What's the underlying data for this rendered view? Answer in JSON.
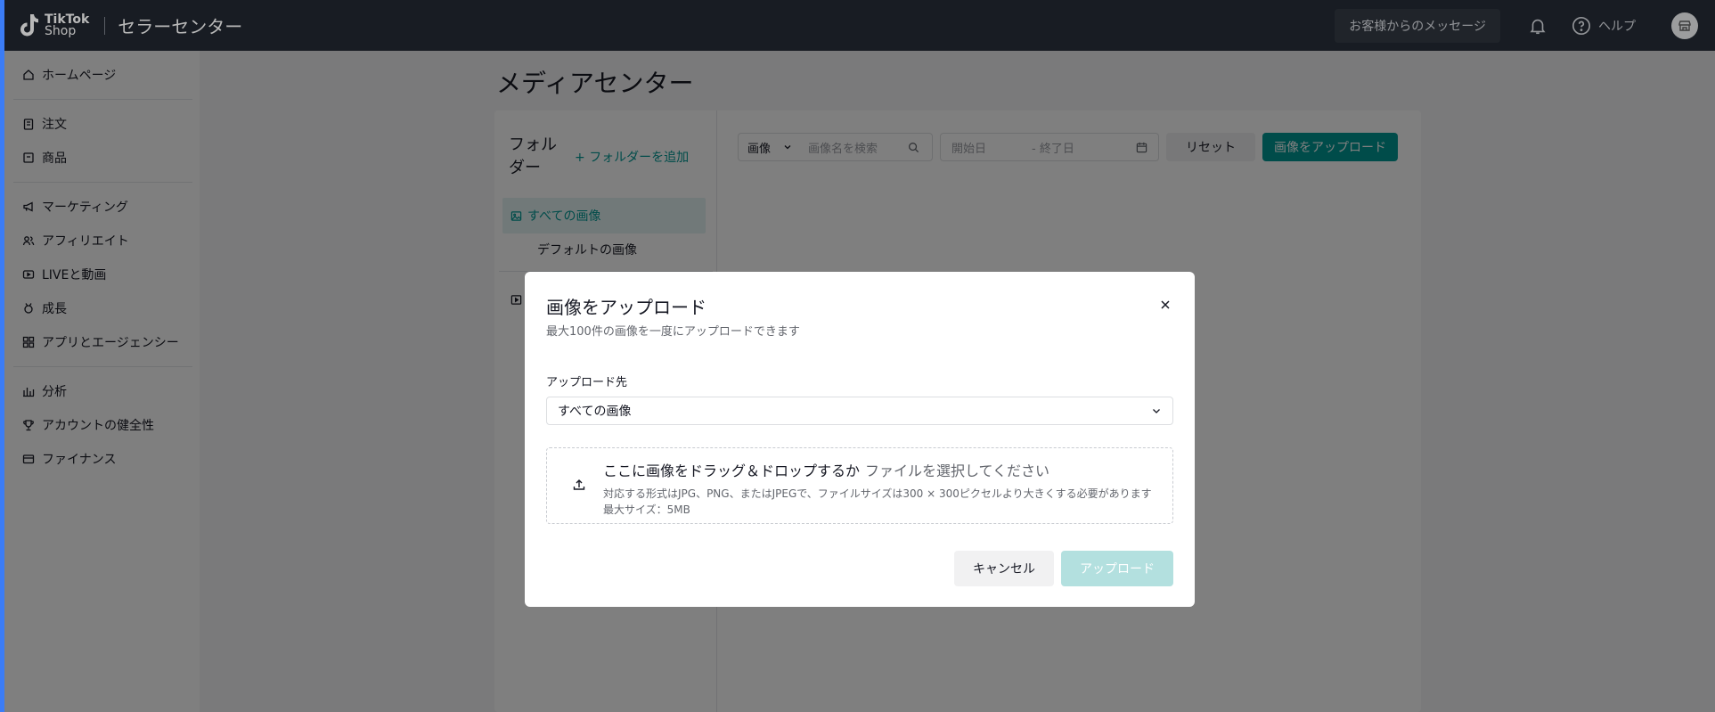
{
  "header": {
    "logo_line1": "TikTok",
    "logo_line2": "Shop",
    "center_title": "セラーセンター",
    "messages_button": "お客様からのメッセージ",
    "help_label": "ヘルプ"
  },
  "sidebar": {
    "groups": [
      [
        {
          "label": "ホームページ",
          "icon": "home-icon"
        }
      ],
      [
        {
          "label": "注文",
          "icon": "clipboard-icon"
        },
        {
          "label": "商品",
          "icon": "box-icon"
        }
      ],
      [
        {
          "label": "マーケティング",
          "icon": "megaphone-icon"
        },
        {
          "label": "アフィリエイト",
          "icon": "users-icon"
        },
        {
          "label": "LIVEと動画",
          "icon": "video-icon"
        },
        {
          "label": "成長",
          "icon": "medal-icon"
        },
        {
          "label": "アプリとエージェンシー",
          "icon": "apps-icon"
        }
      ],
      [
        {
          "label": "分析",
          "icon": "bar-chart-icon"
        },
        {
          "label": "アカウントの健全性",
          "icon": "trophy-icon"
        },
        {
          "label": "ファイナンス",
          "icon": "card-icon"
        }
      ]
    ]
  },
  "main": {
    "page_title": "メディアセンター",
    "folders": {
      "heading": "フォルダー",
      "add_folder": "フォルダーを追加",
      "all_images": "すべての画像",
      "default_images": "デフォルトの画像"
    },
    "filters": {
      "type": "画像",
      "search_placeholder": "画像名を検索",
      "start_date": "開始日",
      "end_date": "- 終了日",
      "reset": "リセット",
      "upload": "画像をアップロード"
    }
  },
  "modal": {
    "title": "画像をアップロード",
    "subtitle": "最大100件の画像を一度にアップロードできます",
    "destination_label": "アップロード先",
    "destination_value": "すべての画像",
    "drop_text": "ここに画像をドラッグ＆ドロップするか",
    "drop_link": "ファイルを選択してください",
    "hint_formats": "対応する形式はJPG、PNG、またはJPEGで、ファイルサイズは300 × 300ピクセルより大きくする必要があります",
    "hint_size": "最大サイズ：5MB",
    "cancel": "キャンセル",
    "submit": "アップロード"
  },
  "colors": {
    "accent": "#009995",
    "topbar": "#222831",
    "left_strip": "#3b7cf6"
  }
}
